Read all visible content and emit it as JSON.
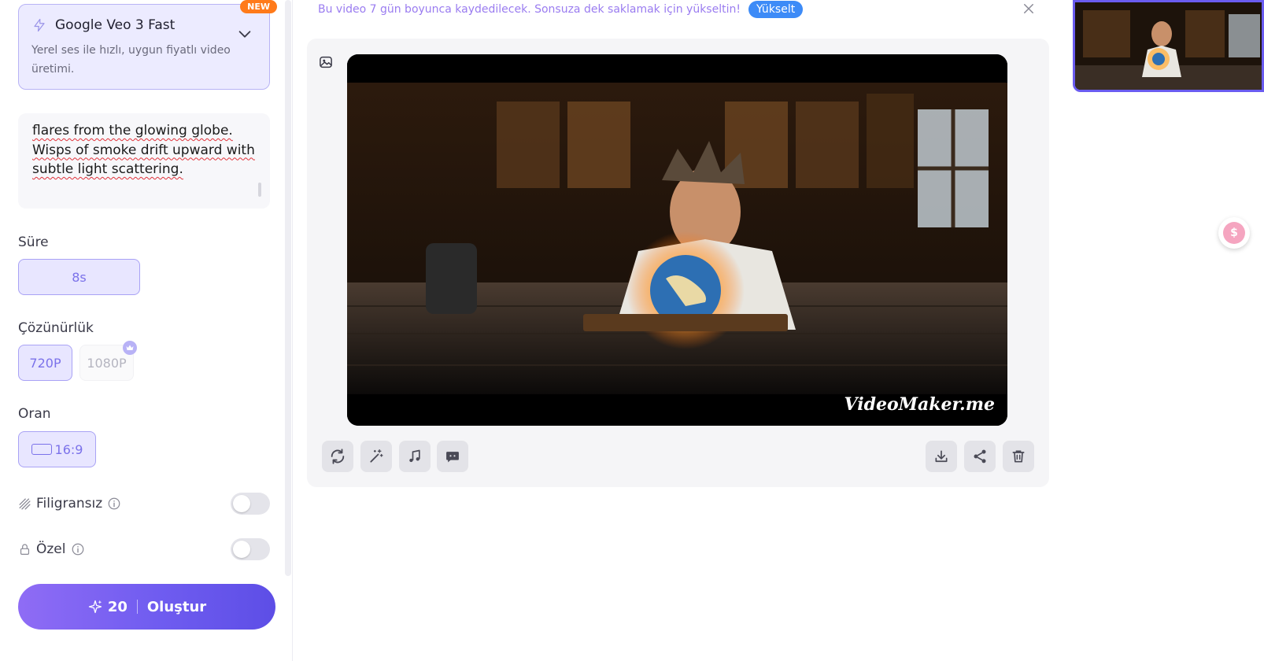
{
  "model": {
    "name": "Google Veo 3 Fast",
    "description": "Yerel ses ile hızlı, uygun fiyatlı video üretimi.",
    "badge": "NEW"
  },
  "prompt": {
    "visible_text": "flares from the glowing globe. Wisps of smoke drift upward with subtle light scattering."
  },
  "duration": {
    "label": "Süre",
    "options": [
      "8s"
    ],
    "selected": "8s"
  },
  "resolution": {
    "label": "Çözünürlük",
    "options": [
      "720P",
      "1080P"
    ],
    "selected": "720P",
    "premium_option": "1080P"
  },
  "ratio": {
    "label": "Oran",
    "options": [
      "16:9"
    ],
    "selected": "16:9"
  },
  "watermark_toggle": {
    "label": "Filigransız",
    "on": false
  },
  "private_toggle": {
    "label": "Özel",
    "on": false
  },
  "create": {
    "credits": "20",
    "label": "Oluştur"
  },
  "banner": {
    "text": "Bu video 7 gün boyunca kaydedilecek. Sonsuza dek saklamak için yükseltin!",
    "upgrade_label": "Yükselt"
  },
  "video": {
    "watermark": "VideoMaker.me"
  },
  "toolbar": {
    "left": [
      "refresh-icon",
      "magic-wand-icon",
      "music-icon",
      "chat-icon"
    ],
    "right": [
      "download-icon",
      "share-icon",
      "trash-icon"
    ]
  },
  "colors": {
    "accent": "#6f5cf0",
    "selected_bg": "#e8e6ff",
    "badge": "#ff7a1a",
    "upgrade": "#3d8bf7"
  }
}
